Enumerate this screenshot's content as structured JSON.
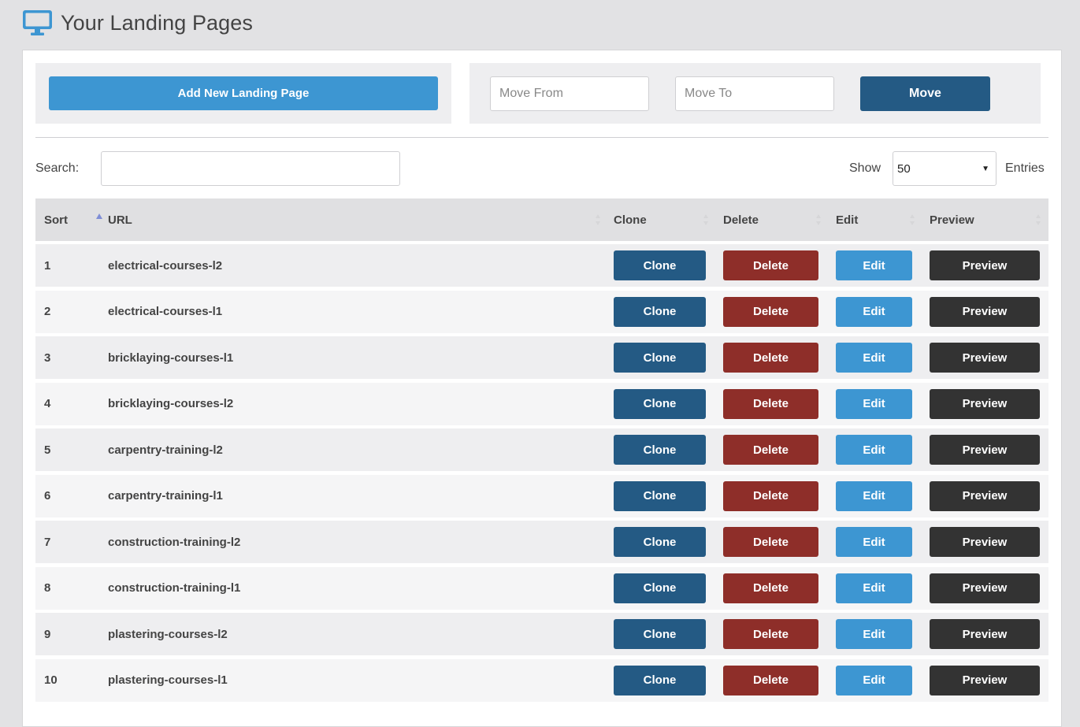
{
  "header": {
    "icon": "desktop-monitor-icon",
    "title": "Your Landing Pages"
  },
  "colors": {
    "page_bg": "#e2e2e4",
    "primary_blue": "#3d96d2",
    "dark_blue": "#245a84",
    "danger_red": "#8e2e29",
    "dark": "#333333",
    "sort_indicator": "#7f8ed6"
  },
  "toolbar": {
    "add_label": "Add New Landing Page",
    "move_from_placeholder": "Move From",
    "move_to_placeholder": "Move To",
    "move_label": "Move"
  },
  "filters": {
    "search_label": "Search:",
    "search_value": "",
    "show_label": "Show",
    "entries_value": "50",
    "entries_label": "Entries"
  },
  "table": {
    "columns": [
      "Sort",
      "URL",
      "Clone",
      "Delete",
      "Edit",
      "Preview"
    ],
    "sorted_column": "Sort",
    "sort_direction": "ascending",
    "action_labels": {
      "clone": "Clone",
      "delete": "Delete",
      "edit": "Edit",
      "preview": "Preview"
    },
    "rows": [
      {
        "sort": "1",
        "url": "electrical-courses-l2"
      },
      {
        "sort": "2",
        "url": "electrical-courses-l1"
      },
      {
        "sort": "3",
        "url": "bricklaying-courses-l1"
      },
      {
        "sort": "4",
        "url": "bricklaying-courses-l2"
      },
      {
        "sort": "5",
        "url": "carpentry-training-l2"
      },
      {
        "sort": "6",
        "url": "carpentry-training-l1"
      },
      {
        "sort": "7",
        "url": "construction-training-l2"
      },
      {
        "sort": "8",
        "url": "construction-training-l1"
      },
      {
        "sort": "9",
        "url": "plastering-courses-l2"
      },
      {
        "sort": "10",
        "url": "plastering-courses-l1"
      }
    ]
  }
}
